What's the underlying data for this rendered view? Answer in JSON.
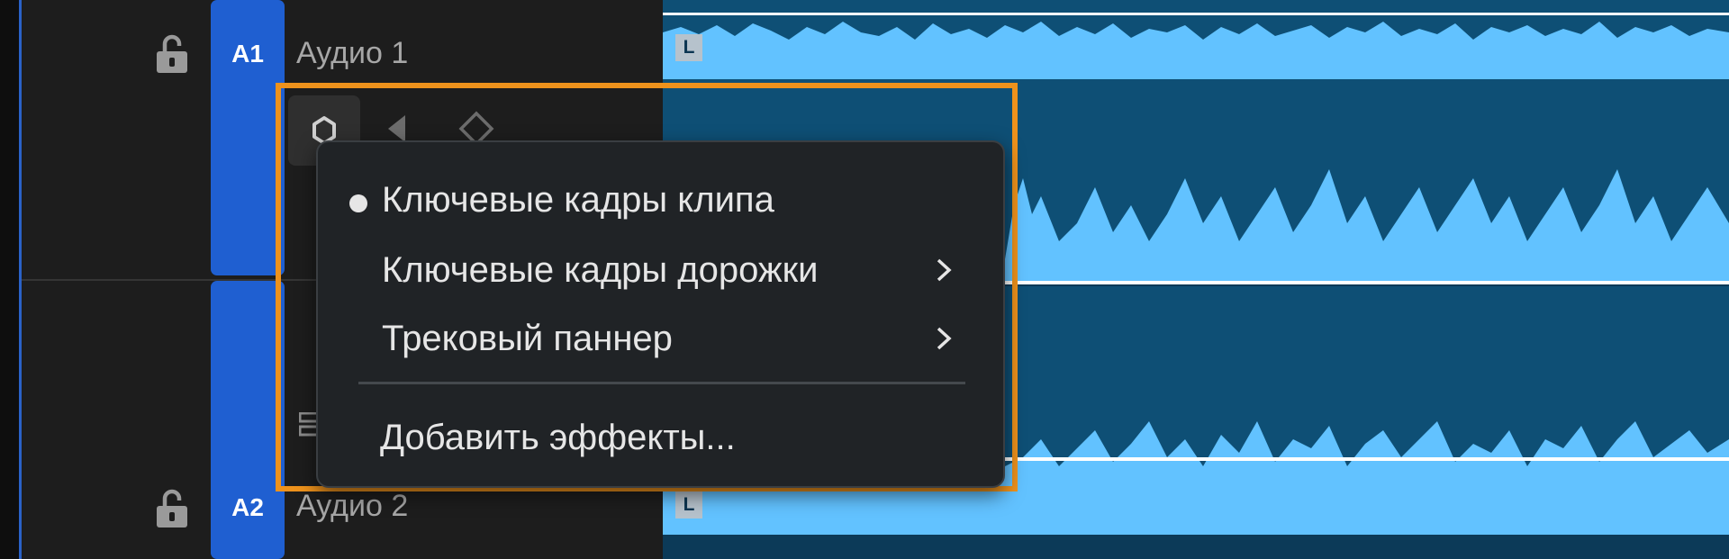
{
  "tracks": [
    {
      "id": "A1",
      "name": "Аудио 1",
      "channel_label": "L",
      "locked": false
    },
    {
      "id": "A2",
      "name": "Аудио 2",
      "channel_label": "L",
      "locked": false
    }
  ],
  "keyframe_tools": {
    "show_keyframes_icon": "keyframe-hexagon-icon",
    "prev_keyframe_icon": "triangle-left-icon",
    "add_keyframe_icon": "diamond-icon"
  },
  "context_menu": {
    "items": [
      {
        "label": "Ключевые кадры клипа",
        "checked": true,
        "has_submenu": false
      },
      {
        "label": "Ключевые кадры дорожки",
        "checked": false,
        "has_submenu": true
      },
      {
        "label": "Трековый паннер",
        "checked": false,
        "has_submenu": true
      },
      {
        "label": "Добавить эффекты...",
        "checked": false,
        "has_submenu": false
      }
    ]
  },
  "colors": {
    "track_target": "#1f5fd1",
    "waveform": "#62c2ff",
    "clip_background": "#0e4f75",
    "highlight": "#ee921c",
    "menu_background": "#202326"
  }
}
